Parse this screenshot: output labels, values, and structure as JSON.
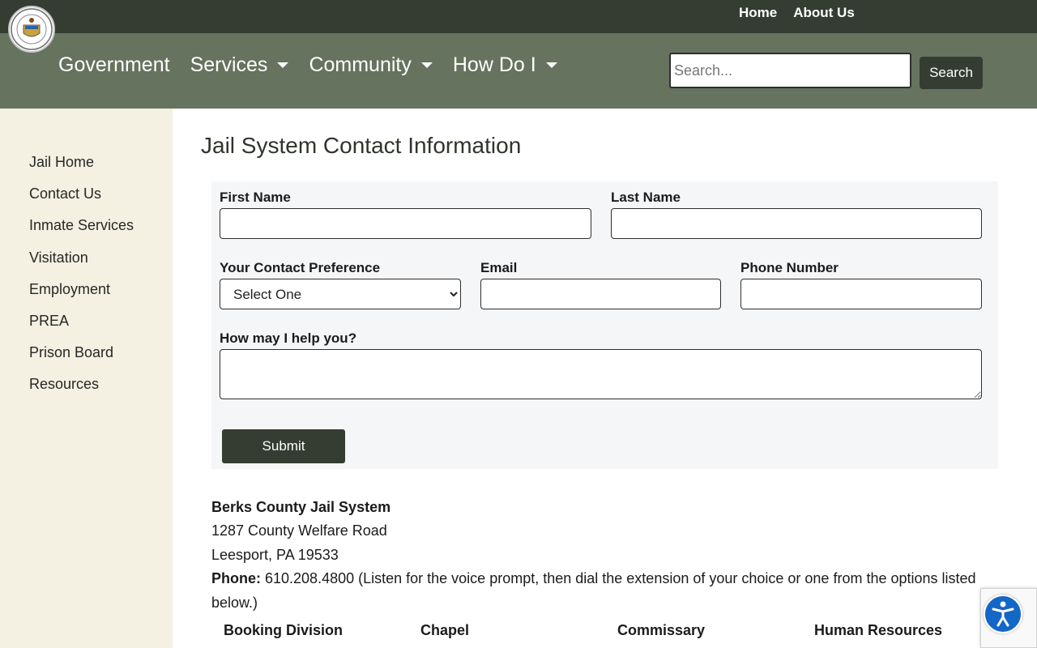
{
  "top_links": [
    "Home",
    "About Us"
  ],
  "nav": {
    "items": [
      "Government",
      "Services",
      "Community",
      "How Do I"
    ]
  },
  "search": {
    "placeholder": "Search...",
    "button": "Search"
  },
  "sidebar": {
    "items": [
      "Jail Home",
      "Contact Us",
      "Inmate Services",
      "Visitation",
      "Employment",
      "PREA",
      "Prison Board",
      "Resources"
    ]
  },
  "page": {
    "title": "Jail System Contact Information"
  },
  "form": {
    "first_name_label": "First Name",
    "first_name_value": "",
    "last_name_label": "Last Name",
    "last_name_value": "",
    "contact_pref_label": "Your Contact Preference",
    "contact_pref_selected": "Select One",
    "email_label": "Email",
    "email_value": "",
    "phone_label": "Phone Number",
    "phone_value": "",
    "help_label": "How may I help you?",
    "help_value": "",
    "submit_label": "Submit"
  },
  "contact": {
    "name": "Berks County Jail System",
    "address1": "1287 County Welfare Road",
    "address2": "Leesport, PA 19533",
    "phone_label": "Phone:",
    "phone_text": " 610.208.4800 (Listen for the voice prompt, then dial the extension of your choice or one from the options listed below.)"
  },
  "divisions": [
    "Booking Division",
    "Chapel",
    "Commissary",
    "Human Resources"
  ],
  "colors": {
    "topbar": "#353d33",
    "navbar": "#66735f",
    "sidebar": "#f4f1e3",
    "button": "#353d33",
    "accessibility": "#1466c7"
  },
  "icons": [
    "county-seal-logo",
    "caret-down-icon",
    "accessibility-icon",
    "recaptcha-badge"
  ]
}
